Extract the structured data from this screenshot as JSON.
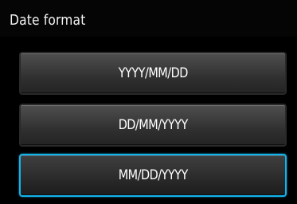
{
  "header": {
    "title": "Date format"
  },
  "options": [
    {
      "label": "YYYY/MM/DD"
    },
    {
      "label": "DD/MM/YYYY"
    },
    {
      "label": "MM/DD/YYYY"
    }
  ],
  "selected_option": "MM/DD/YYYY",
  "colors": {
    "background": "#000000",
    "button_top": "#4e4e4e",
    "button_bottom": "#242424",
    "selected_border": "#13b3ea",
    "text": "#ffffff"
  }
}
